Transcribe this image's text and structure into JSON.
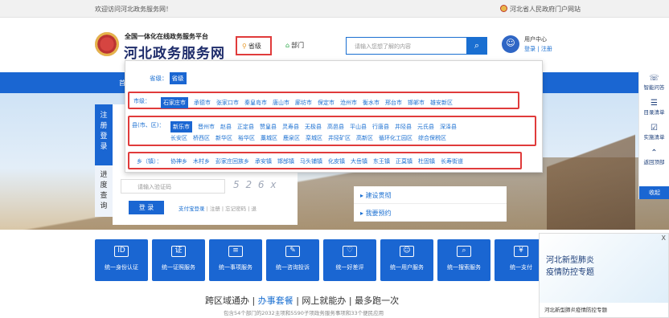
{
  "topbar": {
    "welcome": "欢迎访问河北政务服务网！",
    "gov_link": "河北省人民政府门户网站"
  },
  "header": {
    "subtitle": "全国一体化在线政务服务平台",
    "title": "河北政务服务网",
    "level_button": "省级",
    "dept_button": "部门",
    "search_placeholder": "请输入您想了解的内容",
    "user_title": "用户中心",
    "user_links": "登录 | 注册"
  },
  "navbar": {
    "first_label": "首"
  },
  "dropdown": {
    "level_label": "省级：",
    "level_chip": "省级",
    "city_label": "市级：",
    "cities": [
      "石家庄市",
      "承德市",
      "张家口市",
      "秦皇岛市",
      "唐山市",
      "廊坊市",
      "保定市",
      "沧州市",
      "衡水市",
      "邢台市",
      "邯郸市",
      "雄安新区"
    ],
    "county_label": "县(市、区)：",
    "counties_row1": [
      "新乐市",
      "晋州市",
      "赵县",
      "正定县",
      "赞皇县",
      "灵寿县",
      "无极县",
      "高邑县",
      "平山县",
      "行唐县",
      "井陉县",
      "元氏县",
      "深泽县"
    ],
    "counties_row2": [
      "长安区",
      "桥西区",
      "新华区",
      "裕华区",
      "藁城区",
      "鹿泉区",
      "栾城区",
      "井陉矿区",
      "高新区",
      "循环化工园区",
      "综合保税区"
    ],
    "township_label": "乡（镇）：",
    "townships": [
      "协神乡",
      "木村乡",
      "彭家庄回族乡",
      "承安镇",
      "邯邰镇",
      "马头铺镇",
      "化皮镇",
      "大岳镇",
      "东王镇",
      "正莫镇",
      "杜固镇",
      "长寿街道"
    ]
  },
  "login": {
    "tab_register": "注册登录",
    "tab_progress": "进度查询",
    "captcha_placeholder": "请输入验证码",
    "captcha_text": "5 2 6 x",
    "login_button": "登 录",
    "alipay_link": "支付宝登录",
    "other_links": "| 注册 | 忘记密码 | 退"
  },
  "quick": {
    "items": [
      "建设贯彻",
      "我要预约"
    ]
  },
  "right_rail": {
    "items": [
      {
        "label": "智能问答",
        "icon": "qa-icon"
      },
      {
        "label": "目录清单",
        "icon": "list-icon"
      },
      {
        "label": "实施清单",
        "icon": "checklist-icon"
      },
      {
        "label": "返回顶部",
        "icon": "top-icon"
      }
    ],
    "close_label": "收起"
  },
  "services": {
    "items": [
      {
        "label": "统一身份认证",
        "icon": "id-card-icon",
        "glyph": "ID"
      },
      {
        "label": "统一证照服务",
        "icon": "license-icon",
        "glyph": "证"
      },
      {
        "label": "统一事项服务",
        "icon": "layers-icon",
        "glyph": "≡"
      },
      {
        "label": "统一咨询投诉",
        "icon": "chat-icon",
        "glyph": "✎"
      },
      {
        "label": "统一好差评",
        "icon": "rating-icon",
        "glyph": "♡"
      },
      {
        "label": "统一用户服务",
        "icon": "user-icon",
        "glyph": "☺"
      },
      {
        "label": "统一搜索服务",
        "icon": "search-icon",
        "glyph": "⌕"
      },
      {
        "label": "统一支付",
        "icon": "payment-icon",
        "glyph": "¥"
      }
    ]
  },
  "slogan": {
    "p1": "跨区域通办",
    "sep1": " | ",
    "p2": "办事套餐",
    "sep2": " | ",
    "p3": "网上就能办",
    "sep3": " | ",
    "p4": "最多跑一次"
  },
  "stats": "包含54个部门的2032主项和5590子项政务服务事项和33个便民应用",
  "ad": {
    "close": "X",
    "title_line1": "河北新型肺炎",
    "title_line2": "疫情防控专题",
    "caption": "河北新型肺炎疫情防控专题"
  }
}
